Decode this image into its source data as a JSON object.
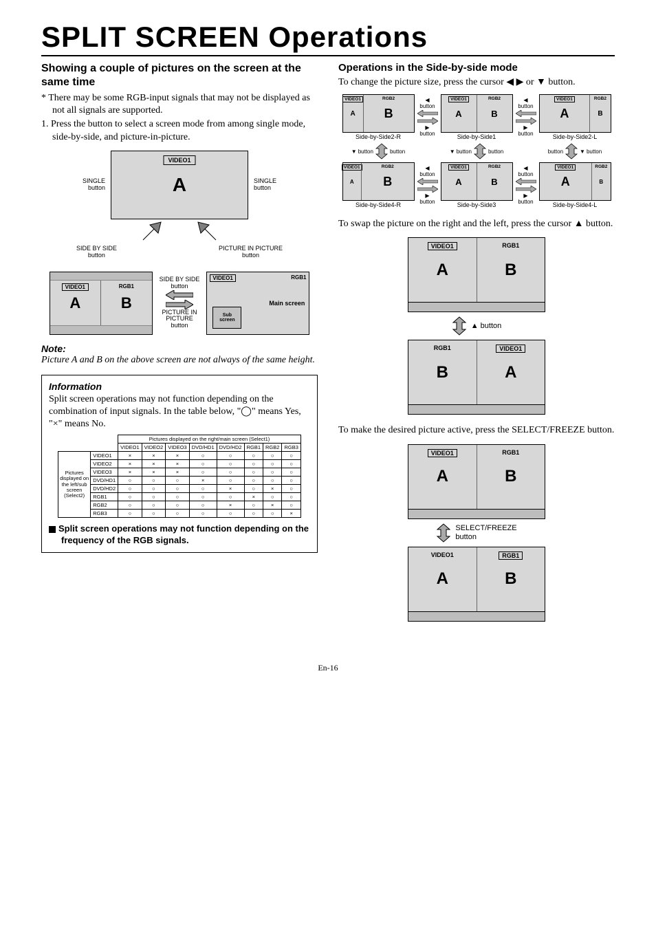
{
  "page_title": "SPLIT SCREEN Operations",
  "left": {
    "heading": "Showing a couple of pictures on the screen at the same time",
    "star_note": "* There may be some RGB-input signals that may not be displayed as not all signals are supported.",
    "step1": "1. Press the button to select a screen mode from among single mode, side-by-side, and picture-in-picture.",
    "main_diag": {
      "tag": "VIDEO1",
      "letter": "A",
      "single_btn_l": "SINGLE\nbutton",
      "single_btn_r": "SINGLE\nbutton",
      "sbs_btn": "SIDE BY SIDE\nbutton",
      "pip_btn": "PICTURE IN PICTURE\nbutton"
    },
    "pair": {
      "sbs_label": "SIDE BY SIDE\nbutton",
      "pip_label": "PICTURE IN\nPICTURE\nbutton",
      "left_tag1": "VIDEO1",
      "left_tag2": "RGB1",
      "left_a": "A",
      "left_b": "B",
      "right_tag1": "VIDEO1",
      "right_tag2": "RGB1",
      "sub": "Sub\nscreen",
      "main": "Main screen"
    },
    "note_h": "Note:",
    "note_body": "Picture A and B on the above screen are not always of the same height.",
    "info_h": "Information",
    "info_body": "Split screen operations may not function depending on the combination of input signals. In the table below, \"◯\" means Yes, \"×\" means No.",
    "table": {
      "caption": "Pictures displayed on the right/main screen (Select1)",
      "row_head": "Pictures\ndisplayed on\nthe left/sub\nscreen\n(Select2)",
      "cols": [
        "VIDEO1",
        "VIDEO2",
        "VIDEO3",
        "DVD/HD1",
        "DVD/HD2",
        "RGB1",
        "RGB2",
        "RGB3"
      ],
      "rows": [
        {
          "sig": "VIDEO1",
          "cells": [
            "×",
            "×",
            "×",
            "○",
            "○",
            "○",
            "○",
            "○"
          ]
        },
        {
          "sig": "VIDEO2",
          "cells": [
            "×",
            "×",
            "×",
            "○",
            "○",
            "○",
            "○",
            "○"
          ]
        },
        {
          "sig": "VIDEO3",
          "cells": [
            "×",
            "×",
            "×",
            "○",
            "○",
            "○",
            "○",
            "○"
          ]
        },
        {
          "sig": "DVD/HD1",
          "cells": [
            "○",
            "○",
            "○",
            "×",
            "○",
            "○",
            "○",
            "○"
          ]
        },
        {
          "sig": "DVD/HD2",
          "cells": [
            "○",
            "○",
            "○",
            "○",
            "×",
            "○",
            "×",
            "○"
          ]
        },
        {
          "sig": "RGB1",
          "cells": [
            "○",
            "○",
            "○",
            "○",
            "○",
            "×",
            "○",
            "○"
          ]
        },
        {
          "sig": "RGB2",
          "cells": [
            "○",
            "○",
            "○",
            "○",
            "×",
            "○",
            "×",
            "○"
          ]
        },
        {
          "sig": "RGB3",
          "cells": [
            "○",
            "○",
            "○",
            "○",
            "○",
            "○",
            "○",
            "×"
          ]
        }
      ]
    },
    "info_bold": "Split screen operations may not function depending on the frequency of the RGB signals."
  },
  "right": {
    "heading": "Operations in the Side-by-side mode",
    "p1": "To change the picture size, press the cursor ◀ ▶ or ▼ button.",
    "grid": {
      "tagL": "VIDEO1",
      "tagR": "RGB2",
      "modes_top": [
        "Side-by-Side2-R",
        "Side-by-Side1",
        "Side-by-Side2-L"
      ],
      "modes_bot": [
        "Side-by-Side4-R",
        "Side-by-Side3",
        "Side-by-Side4-L"
      ],
      "btn": "button",
      "tri_l": "◀",
      "tri_r": "▶",
      "tri_d": "▼"
    },
    "p2": "To swap the picture on the right and the left, press the cursor ▲ button.",
    "swap": {
      "tag1": "VIDEO1",
      "tag2": "RGB1",
      "a": "A",
      "b": "B",
      "btn": "▲ button",
      "tag1b": "RGB1",
      "tag2b": "VIDEO1"
    },
    "p3": "To  make the desired picture active, press the SELECT/FREEZE button.",
    "sel": {
      "btn": "SELECT/FREEZE\nbutton"
    }
  },
  "footer": "En-16"
}
